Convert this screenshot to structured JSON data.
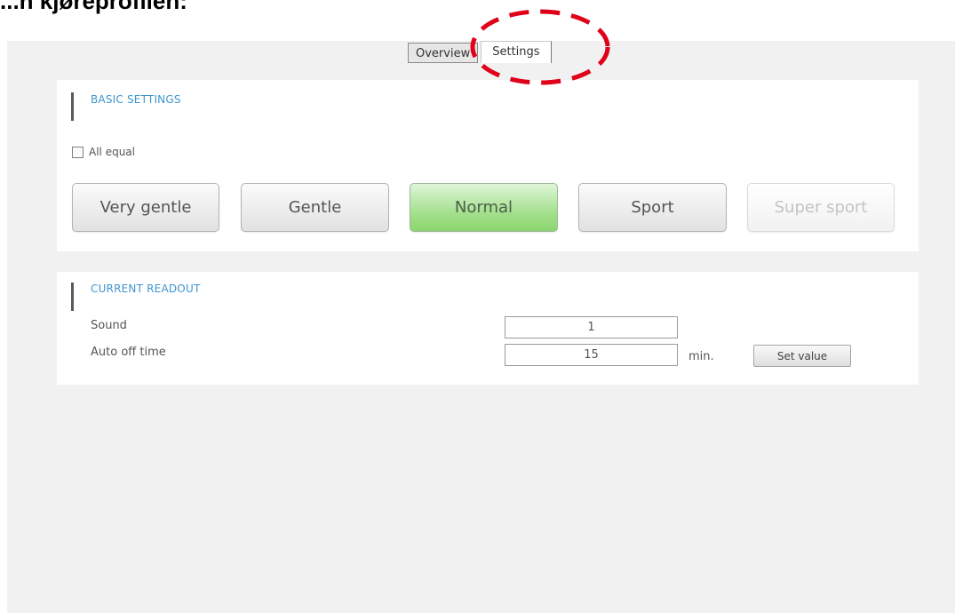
{
  "heading": "...n kjøreprofilen:",
  "tabs": [
    {
      "label": "Overview",
      "active": false
    },
    {
      "label": "Settings",
      "active": true
    }
  ],
  "basic_settings": {
    "title": "BASIC SETTINGS",
    "checkbox_label": "All equal",
    "checkbox_checked": false,
    "modes": [
      {
        "label": "Very gentle",
        "state": "normal"
      },
      {
        "label": "Gentle",
        "state": "normal"
      },
      {
        "label": "Normal",
        "state": "selected"
      },
      {
        "label": "Sport",
        "state": "normal"
      },
      {
        "label": "Super sport",
        "state": "disabled"
      }
    ]
  },
  "current_readout": {
    "title": "CURRENT READOUT",
    "rows": [
      {
        "label": "Sound",
        "value": "1"
      },
      {
        "label": "Auto off time",
        "value": "15",
        "unit": "min."
      }
    ],
    "set_button_label": "Set value"
  },
  "colors": {
    "accent_title": "#3f95cf",
    "selected_mode": "#8bd66e",
    "highlight_ellipse": "#e0001a"
  },
  "annotation": {
    "shape": "dashed-ellipse",
    "target": "tab-settings"
  }
}
